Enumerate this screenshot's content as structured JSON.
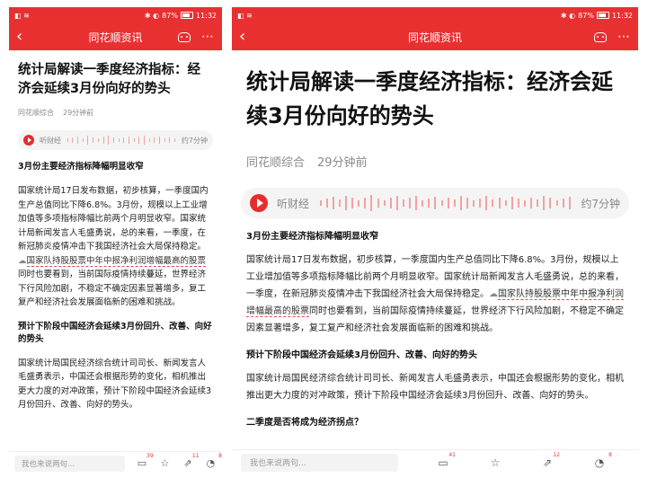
{
  "status": {
    "left": "◧ ≋",
    "right_icons": "✱ ◐",
    "battery": "87%",
    "time": "11:32"
  },
  "nav": {
    "title": "同花顺资讯",
    "back": "‹",
    "more": "⋯"
  },
  "article": {
    "title": "统计局解读一季度经济指标：经济会延续3月份向好的势头",
    "source": "同花顺综合",
    "time": "29分钟前",
    "audio_label": "听财经",
    "audio_duration": "约7分钟",
    "section1": "3月份主要经济指标降幅明显收窄",
    "para1_a": "国家统计局17日发布数据，初步核算，一季度国内生产总值同比下降6.8%。3月份，规模以上工业增加值等多项指标降幅比前两个月明显收窄。国家统计局新闻发言人毛盛勇说，总的来看，一季度，在新冠肺炎疫情冲击下我国经济社会大局保持稳定。",
    "stock_link": "国家队持股股票中年中报净利润增幅最高的股票",
    "para1_b": "同时也要看到，当前国际疫情持续蔓延，世界经济下行风险加剧，不稳定不确定因素显著增多，复工复产和经济社会发展面临新的困难和挑战。",
    "section2": "预计下阶段中国经济会延续3月份回升、改善、向好的势头",
    "para2": "国家统计局国民经济综合统计司司长、新闻发言人毛盛勇表示，中国还会根据形势的变化，相机推出更大力度的对冲政策，预计下阶段中国经济会延续3月份回升、改善、向好的势头。",
    "section3": "二季度是否将成为经济拐点？"
  },
  "bottom": {
    "comment_placeholder": "我也来说两句...",
    "comment_badge": "39",
    "share_badge": "11",
    "like_badge": "8",
    "comment_badge_right": "41",
    "share_badge_right": "12",
    "like_badge_right": "8"
  },
  "colors": {
    "accent": "#e93030"
  },
  "icons": [
    "back-icon",
    "robot-icon",
    "more-icon",
    "play-icon",
    "cloud-icon",
    "comment-icon",
    "star-icon",
    "share-icon",
    "like-icon"
  ]
}
